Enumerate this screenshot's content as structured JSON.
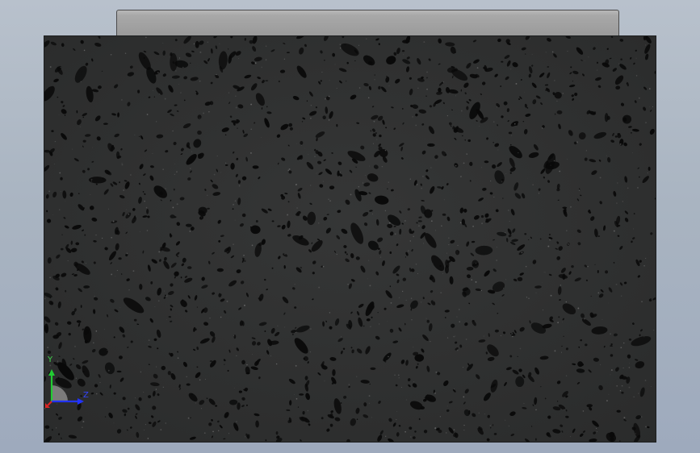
{
  "triad": {
    "y_label": "Y",
    "z_label": "Z",
    "colors": {
      "y_axis": "#22cc33",
      "z_axis": "#2233ff",
      "x_axis": "#d92424"
    }
  },
  "model": {
    "front_face_color": "#2f3030",
    "top_face_color": "#a3a3a3",
    "pore_color": "#090909",
    "speckle_color": "#7a7a7a"
  }
}
